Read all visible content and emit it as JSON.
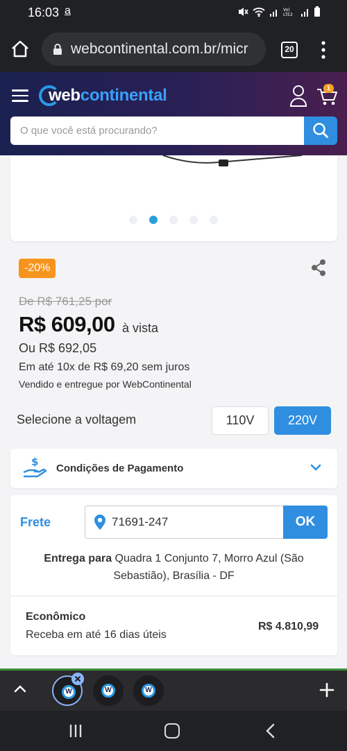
{
  "status_bar": {
    "time": "16:03",
    "app_icon_letter": "a"
  },
  "browser": {
    "url": "webcontinental.com.br/micr",
    "tab_count": "20"
  },
  "site_header": {
    "logo_web": "web",
    "logo_continental": "continental",
    "cart_count": "1",
    "search_placeholder": "O que você está procurando?"
  },
  "product": {
    "discount_badge": "-20%",
    "old_price": "De R$ 761,25 por",
    "price": "R$ 609,00",
    "price_suffix": "à vista",
    "alt_price": "Ou R$ 692,05",
    "installments": "Em até 10x de R$ 69,20 sem juros",
    "seller": "Vendido e entregue por WebContinental",
    "gallery_dots": 5,
    "gallery_active_index": 1
  },
  "voltage": {
    "label": "Selecione a voltagem",
    "options": [
      "110V",
      "220V"
    ],
    "selected": "220V"
  },
  "payment": {
    "label": "Condições de Pagamento"
  },
  "shipping": {
    "label": "Frete",
    "cep": "71691-247",
    "ok_label": "OK",
    "delivery_prefix": "Entrega para",
    "delivery_address": "Quadra 1 Conjunto 7, Morro Azul (São Sebastião), Brasília - DF",
    "option_name": "Econômico",
    "option_time": "Receba em até 16 dias úteis",
    "option_price": "R$ 4.810,99"
  },
  "tab_switcher": {
    "tab_favicon_letter": "W"
  },
  "colors": {
    "accent": "#2f8ee0",
    "discount": "#f6941e",
    "header_dark": "#1a2150"
  }
}
